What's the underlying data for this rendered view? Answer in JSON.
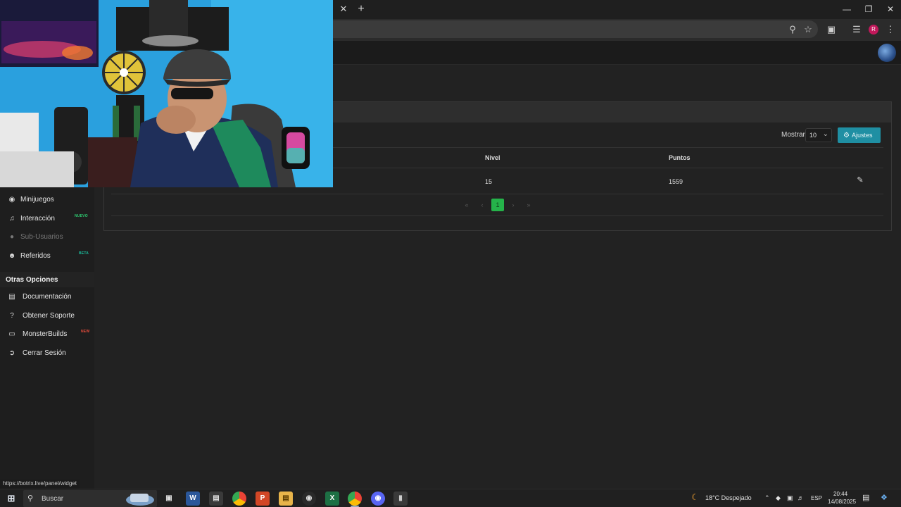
{
  "browser": {
    "close_tab": "✕",
    "new_tab": "+",
    "profile_initial": "R"
  },
  "status_url": "https://botrix.live/panel/widget",
  "table_controls": {
    "show_label": "Mostrar:",
    "show_value": "10",
    "settings_label": "Ajustes"
  },
  "table": {
    "columns": [
      "Nivel",
      "Puntos"
    ],
    "rows": [
      {
        "nivel": "15",
        "puntos": "1559"
      }
    ]
  },
  "pagination": {
    "current": "1"
  },
  "sidebar": {
    "items": [
      {
        "label": "Minijuegos",
        "icon": "gamepad-icon"
      },
      {
        "label": "Interacción",
        "icon": "music-icon",
        "badge": "NUEVO"
      },
      {
        "label": "Sub-Usuarios",
        "icon": "users-icon"
      },
      {
        "label": "Referidos",
        "icon": "referrals-icon",
        "badge": "BETA"
      }
    ],
    "section_title": "Otras Opciones",
    "other_items": [
      {
        "label": "Documentación",
        "icon": "book-icon"
      },
      {
        "label": "Obtener Soporte",
        "icon": "help-icon"
      },
      {
        "label": "MonsterBuilds",
        "icon": "laptop-icon",
        "badge": "NEW"
      },
      {
        "label": "Cerrar Sesión",
        "icon": "logout-icon"
      }
    ]
  },
  "taskbar": {
    "search_placeholder": "Buscar",
    "weather": "18°C  Despejado",
    "language": "ESP",
    "time": "20:44",
    "date": "14/08/2025"
  },
  "colors": {
    "accent_green": "#25b34a",
    "settings_button": "#1f8fa3",
    "badge_new": "#2ecc71",
    "badge_beta": "#1abc9c",
    "badge_monster": "#e74c3c"
  }
}
